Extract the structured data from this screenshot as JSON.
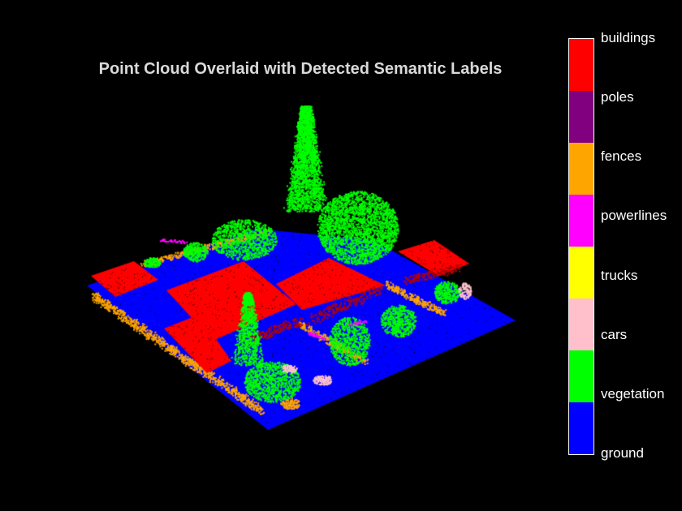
{
  "figure": {
    "title": "Point Cloud Overlaid with Detected Semantic Labels",
    "background": "#000000"
  },
  "colorbar": {
    "classes": [
      {
        "label": "buildings",
        "color": "#ff0000"
      },
      {
        "label": "poles",
        "color": "#800080"
      },
      {
        "label": "fences",
        "color": "#ffa500"
      },
      {
        "label": "powerlines",
        "color": "#ff00ff"
      },
      {
        "label": "trucks",
        "color": "#ffff00"
      },
      {
        "label": "cars",
        "color": "#ffc0cb"
      },
      {
        "label": "vegetation",
        "color": "#00ff00"
      },
      {
        "label": "ground",
        "color": "#0000ff"
      }
    ]
  }
}
